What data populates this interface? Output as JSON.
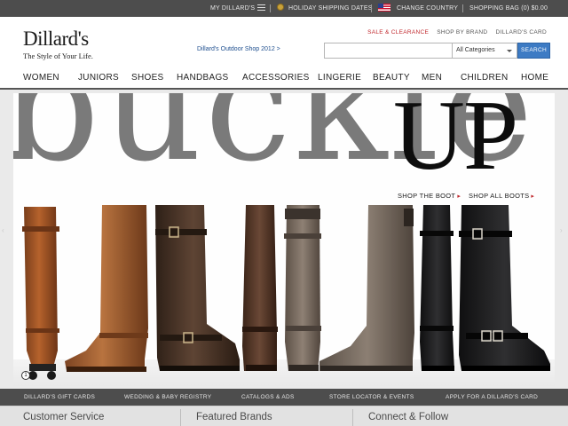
{
  "topbar": {
    "my_dillards": "MY DILLARD'S",
    "holiday_shipping": "HOLIDAY SHIPPING DATES",
    "change_country": "CHANGE COUNTRY",
    "shopping_bag": "SHOPPING BAG",
    "bag_count": "(0)",
    "bag_total": "$0.00"
  },
  "header": {
    "logo": "Dillard's",
    "tagline": "The Style of Your Life.",
    "promo_link": "Dillard's Outdoor Shop 2012 >",
    "util_links": {
      "sale": "SALE & CLEARANCE",
      "brand": "SHOP BY BRAND",
      "card": "DILLARD'S CARD"
    },
    "search": {
      "value": "",
      "category": "All Categories",
      "button": "SEARCH"
    }
  },
  "nav": [
    "WOMEN",
    "JUNIORS",
    "SHOES",
    "HANDBAGS",
    "ACCESSORIES",
    "LINGERIE",
    "BEAUTY",
    "MEN",
    "CHILDREN",
    "HOME"
  ],
  "hero": {
    "headline_1": "buckle",
    "headline_2": "UP",
    "cta_1": "SHOP THE BOOT",
    "cta_2": "SHOP ALL BOOTS",
    "arrow": "▸",
    "slide_number": "1"
  },
  "services": [
    "DILLARD'S GIFT CARDS",
    "WEDDING & BABY REGISTRY",
    "CATALOGS & ADS",
    "STORE LOCATOR & EVENTS",
    "APPLY FOR A DILLARD'S CARD"
  ],
  "footer": [
    "Customer Service",
    "Featured Brands",
    "Connect & Follow"
  ],
  "colors": {
    "accent_blue": "#3d7bc4",
    "sale_red": "#c0282d",
    "bar_grey": "#4d4d4d"
  },
  "icons": {
    "menu": "hamburger-icon",
    "holiday": "holiday-ornament-icon",
    "country": "us-flag-icon",
    "select": "chevron-down-icon"
  }
}
